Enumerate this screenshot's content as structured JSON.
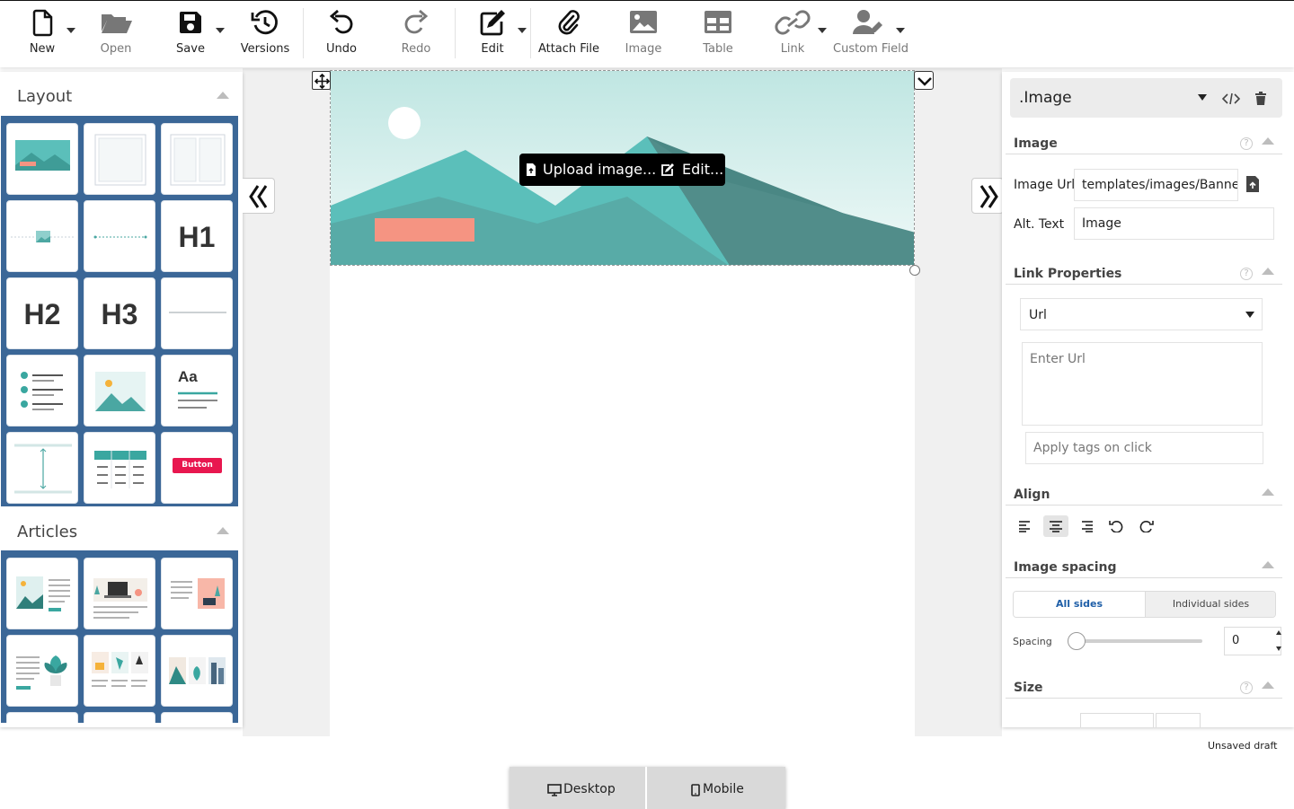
{
  "toolbar": {
    "new_label": "New",
    "open_label": "Open",
    "save_label": "Save",
    "versions_label": "Versions",
    "undo_label": "Undo",
    "redo_label": "Redo",
    "edit_label": "Edit",
    "attach_label": "Attach File",
    "image_label": "Image",
    "table_label": "Table",
    "link_label": "Link",
    "custom_field_label": "Custom Field"
  },
  "left_panel": {
    "layout_title": "Layout",
    "articles_title": "Articles",
    "blocks": {
      "h1": "H1",
      "h2": "H2",
      "h3": "H3",
      "typography": "Aa",
      "button": "Button"
    }
  },
  "canvas": {
    "upload_label": "Upload image...",
    "edit_label": "Edit..."
  },
  "right_panel": {
    "element_name": ".Image",
    "image_section": "Image",
    "image_url_label": "Image Url",
    "image_url_value": "templates/images/Banne",
    "alt_text_label": "Alt. Text",
    "alt_text_value": "Image",
    "link_section": "Link Properties",
    "link_type": "Url",
    "url_placeholder": "Enter Url",
    "tags_placeholder": "Apply tags on click",
    "align_section": "Align",
    "spacing_section": "Image spacing",
    "all_sides": "All sides",
    "individual_sides": "Individual sides",
    "spacing_label": "Spacing",
    "spacing_value": "0",
    "size_section": "Size",
    "help_glyph": "?"
  },
  "status": {
    "draft_text": "Unsaved draft"
  },
  "view_switch": {
    "desktop_label": "Desktop",
    "mobile_label": "Mobile"
  },
  "colors": {
    "block_area": "#3b6797",
    "teal": "#5bbfba",
    "accent_pink": "#e8174f",
    "coral": "#f59482",
    "active_blue": "#1f5fa8"
  }
}
